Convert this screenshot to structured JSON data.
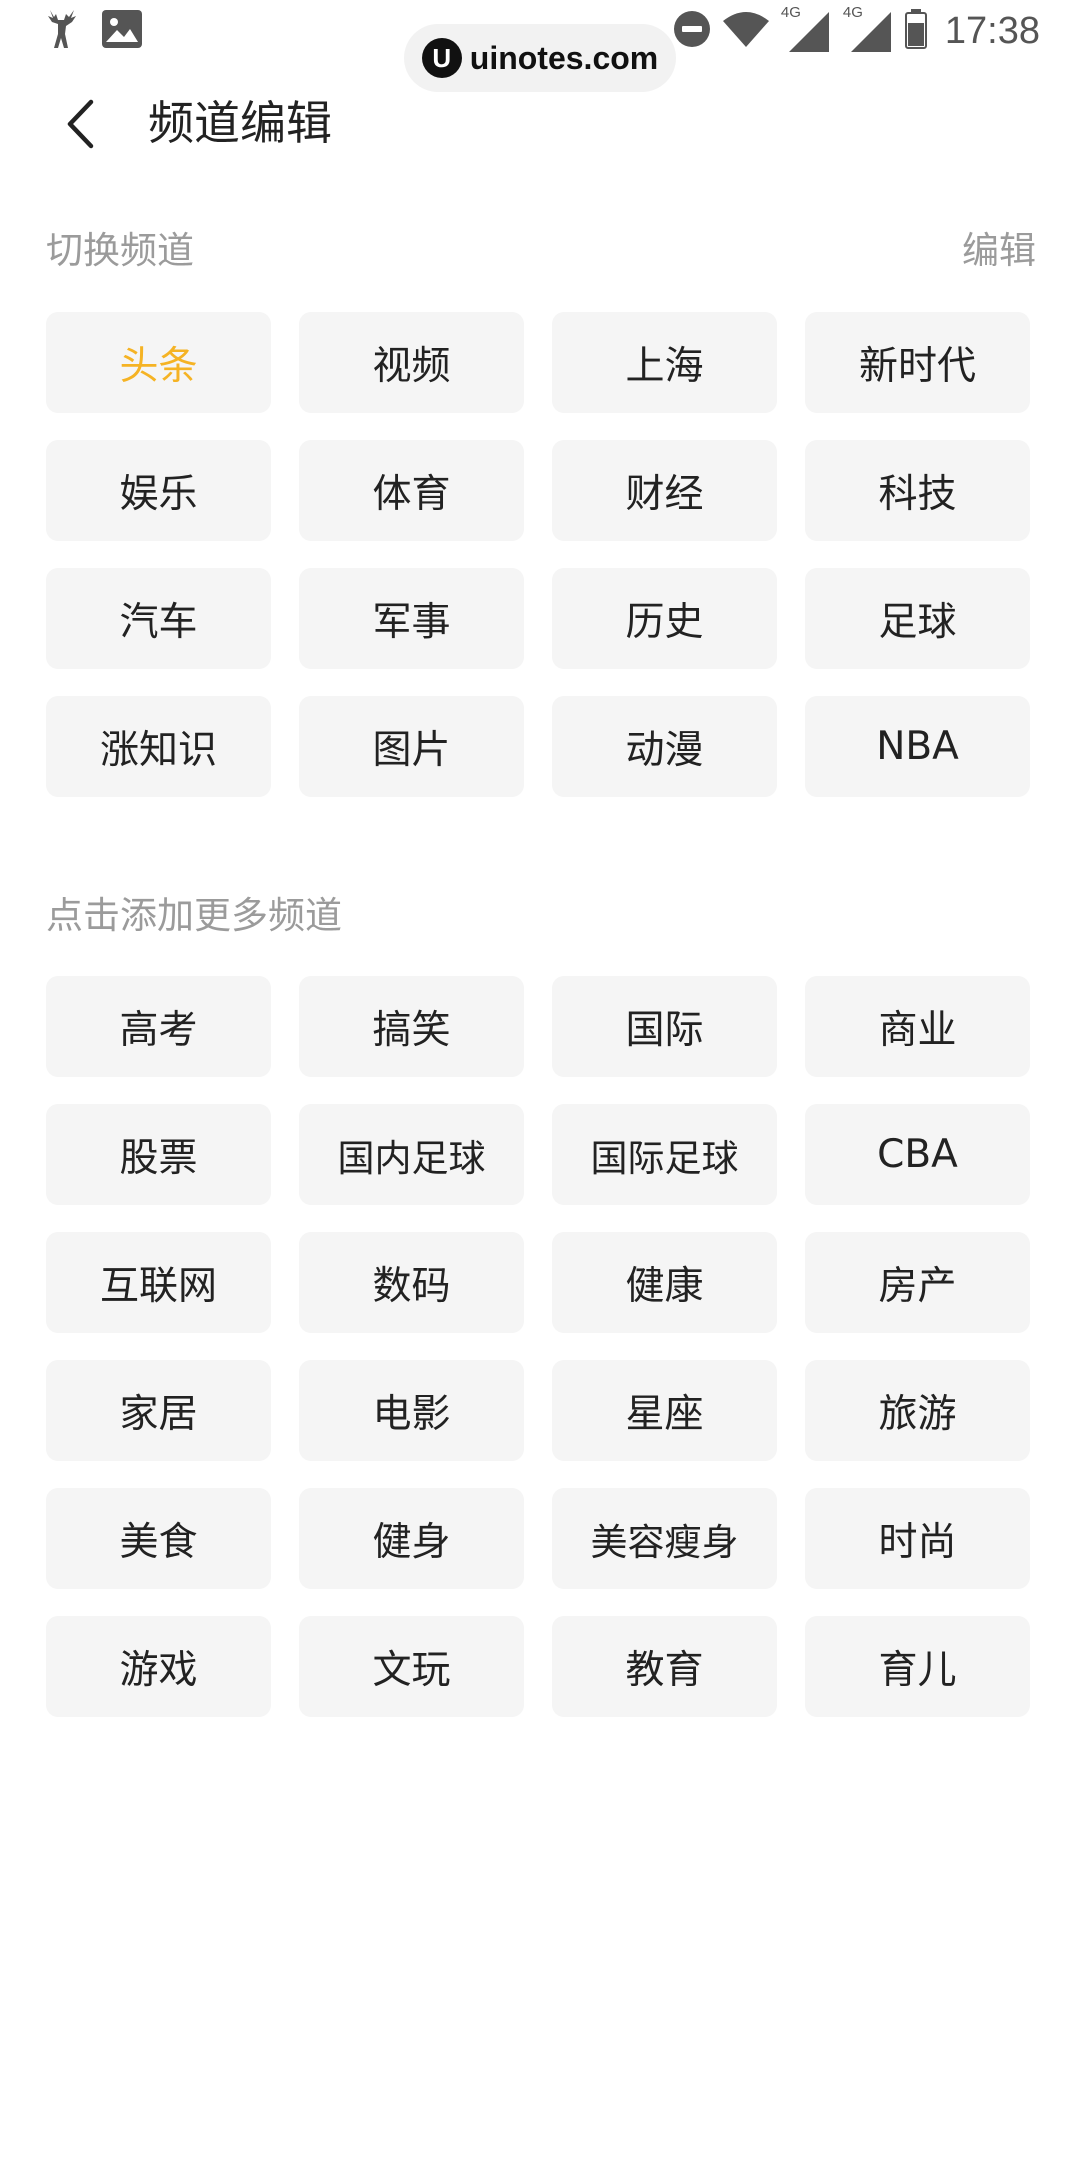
{
  "status_bar": {
    "time": "17:38",
    "network_label_1": "4G",
    "network_label_2": "4G"
  },
  "watermark": {
    "logo_letter": "U",
    "text": "uinotes.com"
  },
  "header": {
    "title": "频道编辑"
  },
  "current_channels": {
    "label": "切换频道",
    "edit_label": "编辑",
    "items": [
      {
        "label": "头条",
        "active": true
      },
      {
        "label": "视频"
      },
      {
        "label": "上海"
      },
      {
        "label": "新时代"
      },
      {
        "label": "娱乐"
      },
      {
        "label": "体育"
      },
      {
        "label": "财经"
      },
      {
        "label": "科技"
      },
      {
        "label": "汽车"
      },
      {
        "label": "军事"
      },
      {
        "label": "历史"
      },
      {
        "label": "足球"
      },
      {
        "label": "涨知识"
      },
      {
        "label": "图片"
      },
      {
        "label": "动漫"
      },
      {
        "label": "NBA"
      }
    ]
  },
  "more_channels": {
    "label": "点击添加更多频道",
    "items": [
      {
        "label": "高考"
      },
      {
        "label": "搞笑"
      },
      {
        "label": "国际"
      },
      {
        "label": "商业"
      },
      {
        "label": "股票"
      },
      {
        "label": "国内足球"
      },
      {
        "label": "国际足球"
      },
      {
        "label": "CBA"
      },
      {
        "label": "互联网"
      },
      {
        "label": "数码"
      },
      {
        "label": "健康"
      },
      {
        "label": "房产"
      },
      {
        "label": "家居"
      },
      {
        "label": "电影"
      },
      {
        "label": "星座"
      },
      {
        "label": "旅游"
      },
      {
        "label": "美食"
      },
      {
        "label": "健身"
      },
      {
        "label": "美容瘦身"
      },
      {
        "label": "时尚"
      },
      {
        "label": "游戏"
      },
      {
        "label": "文玩"
      },
      {
        "label": "教育"
      },
      {
        "label": "育儿"
      }
    ]
  },
  "colors": {
    "accent": "#f5b324",
    "chip_bg": "#f5f5f5",
    "secondary_text": "#9b9b9b"
  }
}
